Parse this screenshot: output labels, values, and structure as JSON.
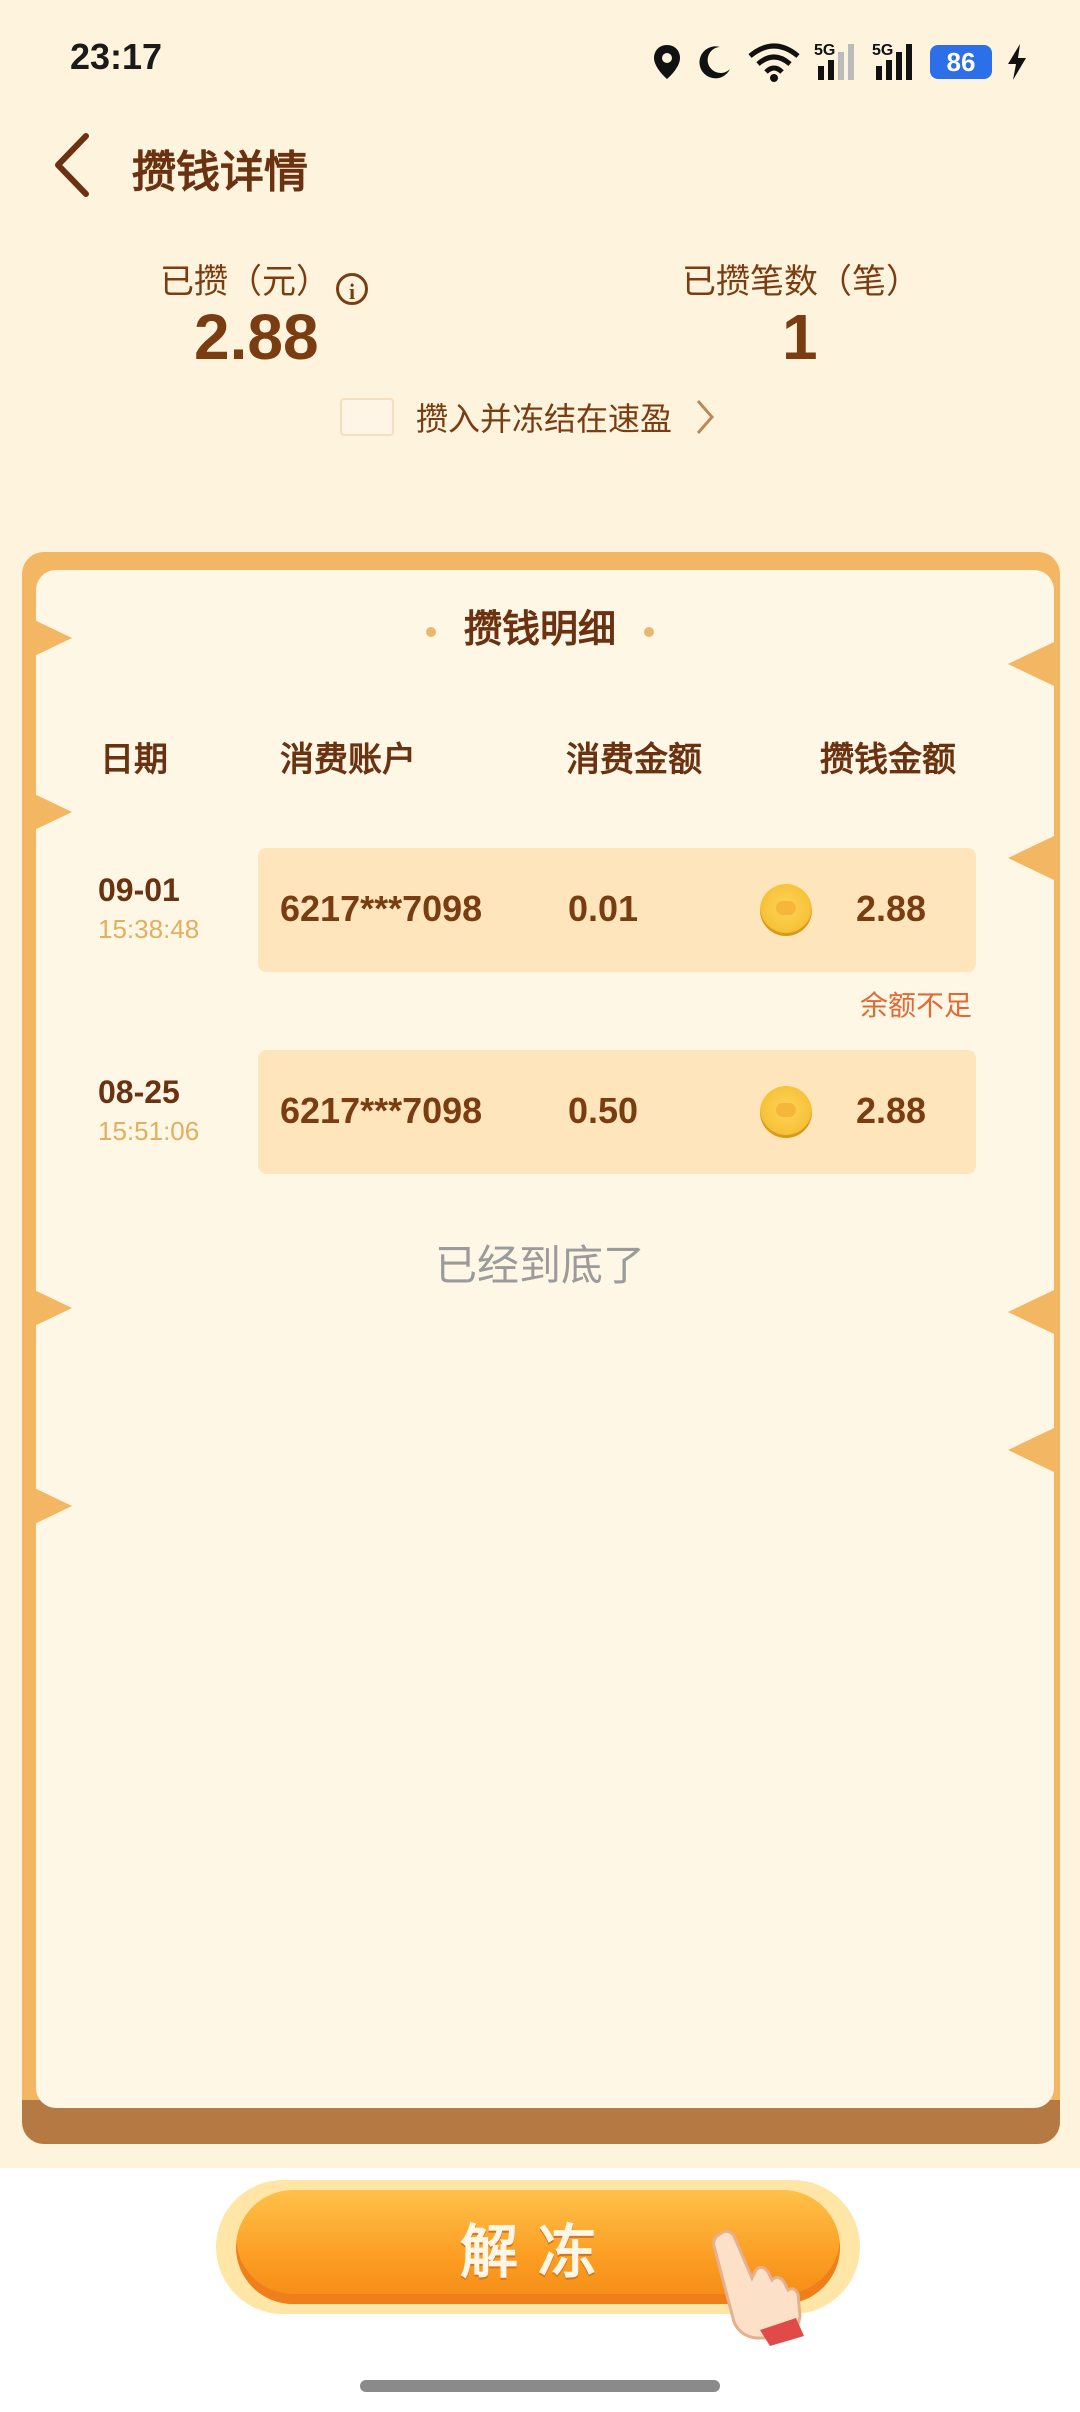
{
  "status": {
    "time": "23:17",
    "battery": "86",
    "net1": "5G",
    "net2": "5G"
  },
  "header": {
    "title": "攒钱详情"
  },
  "stats": {
    "saved_label": "已攒（元）",
    "saved_value": "2.88",
    "count_label": "已攒笔数（笔）",
    "count_value": "1"
  },
  "frozen_link": {
    "label": "攒入并冻结在速盈"
  },
  "detail": {
    "title": "攒钱明细",
    "columns": [
      "日期",
      "消费账户",
      "消费金额",
      "攒钱金额"
    ],
    "rows": [
      {
        "date": "09-01",
        "time": "15:38:48",
        "account": "6217***7098",
        "amount": "0.01",
        "saved": "2.88",
        "note": "余额不足"
      },
      {
        "date": "08-25",
        "time": "15:51:06",
        "account": "6217***7098",
        "amount": "0.50",
        "saved": "2.88",
        "note": ""
      }
    ],
    "end_text": "已经到底了"
  },
  "action": {
    "unfreeze_label": "解冻"
  },
  "colors": {
    "accent": "#f7a02a",
    "text_brown": "#7a3d12",
    "panel_border": "#f3b662",
    "row_bg": "#ffe5bb"
  }
}
